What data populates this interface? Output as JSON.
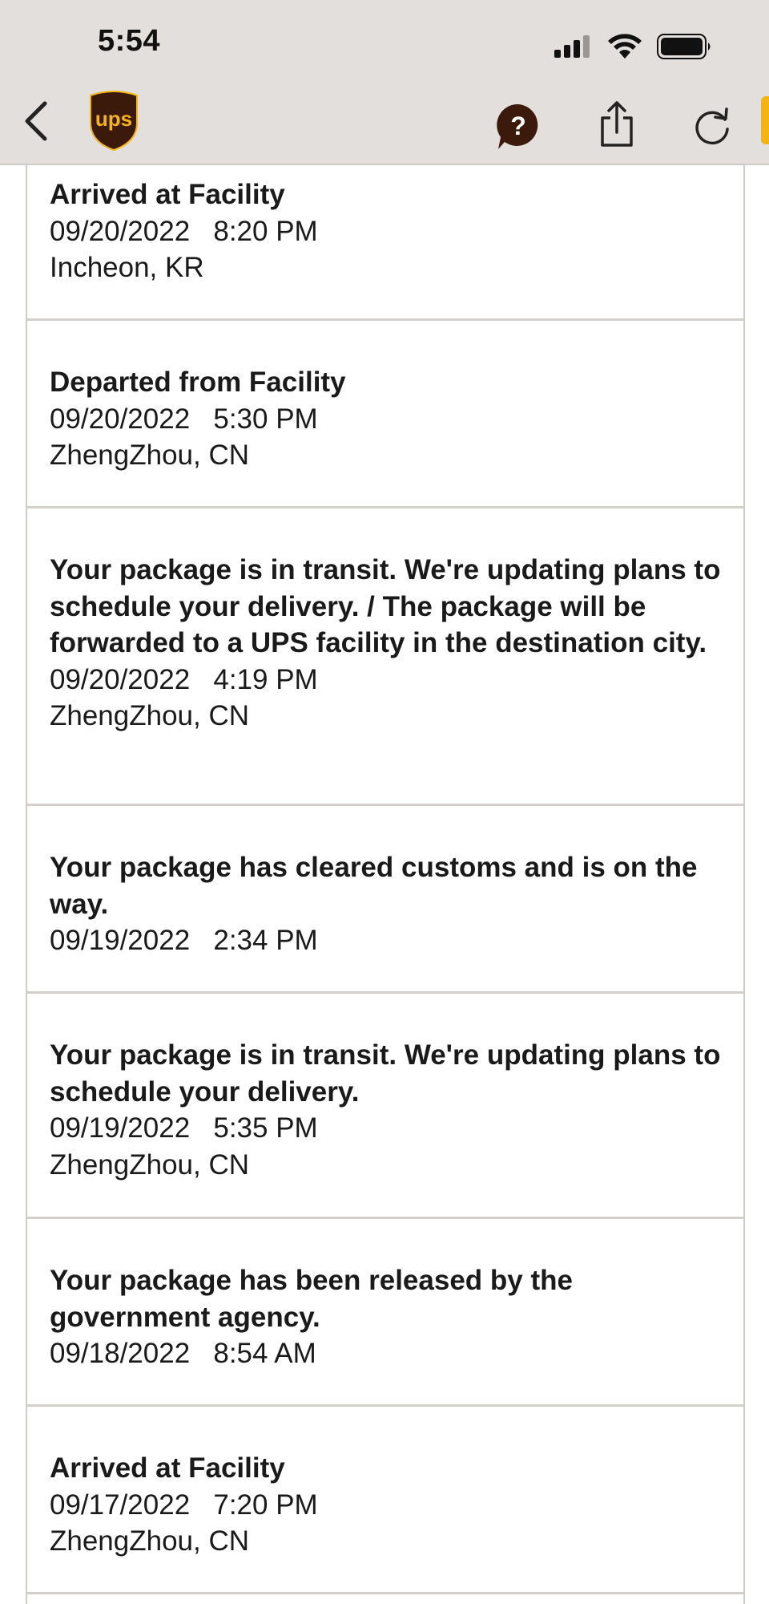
{
  "status_bar": {
    "time": "5:54",
    "icons": [
      "cellular-signal-icon",
      "wifi-icon",
      "battery-icon"
    ]
  },
  "nav": {
    "icons": [
      "back-chevron-icon",
      "ups-logo",
      "help-icon",
      "share-icon",
      "refresh-icon"
    ],
    "brand": "ups",
    "help_glyph": "?"
  },
  "colors": {
    "topbar": "#e2dfdc",
    "ups_brown": "#3b1a0c",
    "ups_gold": "#f5b40f",
    "divider": "#d3d0cc"
  },
  "events": [
    {
      "title": "Arrived at Facility",
      "date": "09/20/2022",
      "time": "8:20 PM",
      "location": "Incheon, KR"
    },
    {
      "title": "Departed from Facility",
      "date": "09/20/2022",
      "time": "5:30 PM",
      "location": "ZhengZhou, CN"
    },
    {
      "title": "Your package is in transit. We're updating plans to schedule your delivery. / The package will be forwarded to a UPS facility in the destination city.",
      "date": "09/20/2022",
      "time": "4:19 PM",
      "location": "ZhengZhou, CN"
    },
    {
      "title": "Your package has cleared customs and is on the way.",
      "date": "09/19/2022",
      "time": "2:34 PM",
      "location": ""
    },
    {
      "title": "Your package is in transit. We're updating plans to schedule your delivery.",
      "date": "09/19/2022",
      "time": "5:35 PM",
      "location": "ZhengZhou, CN"
    },
    {
      "title": "Your package has been released by the government agency.",
      "date": "09/18/2022",
      "time": "8:54 AM",
      "location": ""
    },
    {
      "title": "Arrived at Facility",
      "date": "09/17/2022",
      "time": "7:20 PM",
      "location": "ZhengZhou, CN"
    }
  ]
}
